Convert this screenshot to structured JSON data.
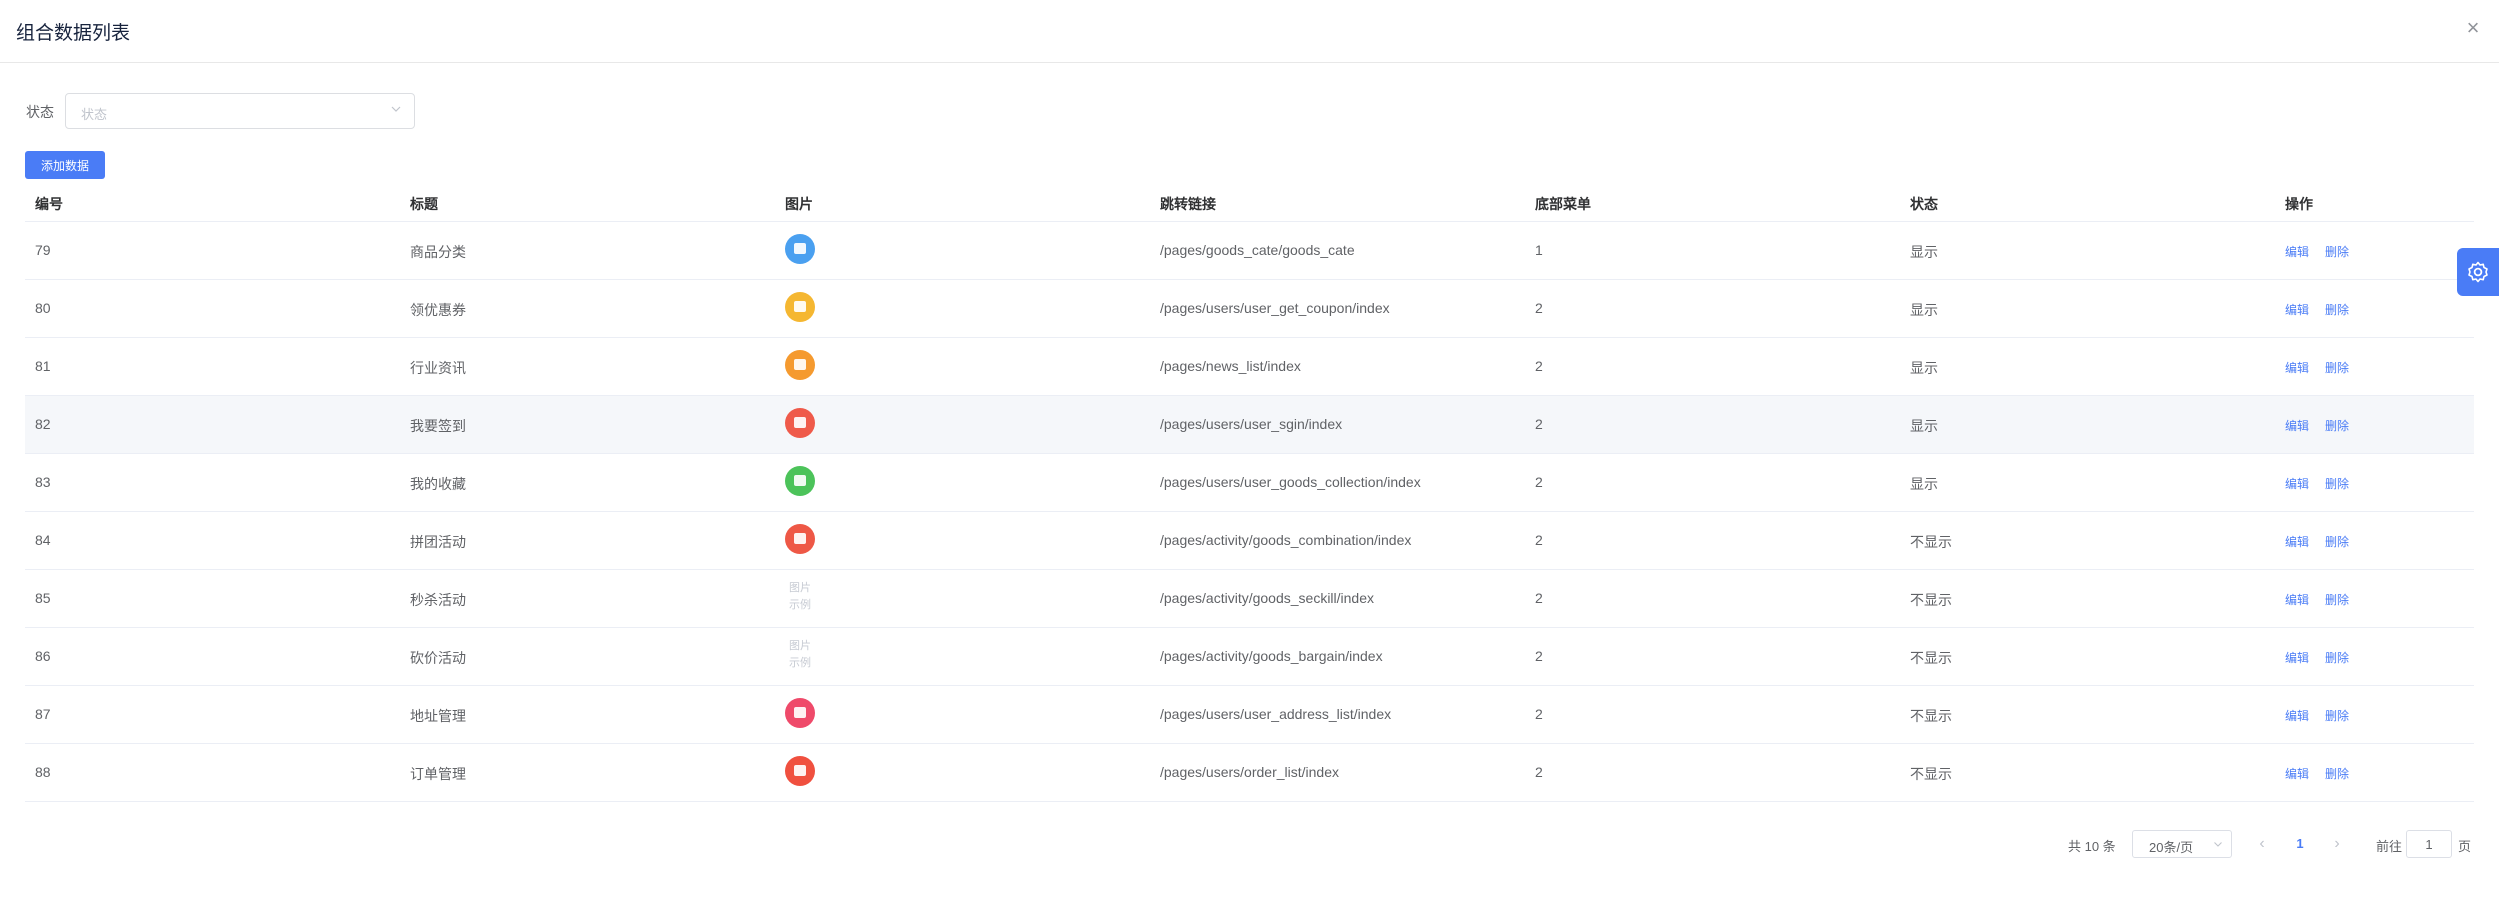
{
  "dialog": {
    "title": "组合数据列表",
    "close": "×"
  },
  "filter": {
    "label": "状态",
    "placeholder": "状态"
  },
  "toolbar": {
    "add_label": "添加数据"
  },
  "table": {
    "headers": [
      "编号",
      "标题",
      "图片",
      "跳转链接",
      "底部菜单",
      "状态",
      "操作"
    ],
    "rows": [
      {
        "id": "79",
        "title": "商品分类",
        "icon": "shop-icon",
        "color": "#4aa0f0",
        "link": "/pages/goods_cate/goods_cate",
        "menu": "1",
        "status": "显示"
      },
      {
        "id": "80",
        "title": "领优惠券",
        "icon": "coupon-icon",
        "color": "#f5b731",
        "link": "/pages/users/user_get_coupon/index",
        "menu": "2",
        "status": "显示"
      },
      {
        "id": "81",
        "title": "行业资讯",
        "icon": "news-icon",
        "color": "#f59a2f",
        "link": "/pages/news_list/index",
        "menu": "2",
        "status": "显示"
      },
      {
        "id": "82",
        "title": "我要签到",
        "icon": "calendar-icon",
        "color": "#ef5a4a",
        "link": "/pages/users/user_sgin/index",
        "menu": "2",
        "status": "显示"
      },
      {
        "id": "83",
        "title": "我的收藏",
        "icon": "collection-icon",
        "color": "#4cc35a",
        "link": "/pages/users/user_goods_collection/index",
        "menu": "2",
        "status": "显示"
      },
      {
        "id": "84",
        "title": "拼团活动",
        "icon": "group-buy-icon",
        "color": "#ee5846",
        "link": "/pages/activity/goods_combination/index",
        "menu": "2",
        "status": "不显示"
      },
      {
        "id": "85",
        "title": "秒杀活动",
        "icon": "image-placeholder-icon",
        "color": "",
        "link": "/pages/activity/goods_seckill/index",
        "menu": "2",
        "status": "不显示"
      },
      {
        "id": "86",
        "title": "砍价活动",
        "icon": "image-placeholder-icon",
        "color": "",
        "link": "/pages/activity/goods_bargain/index",
        "menu": "2",
        "status": "不显示"
      },
      {
        "id": "87",
        "title": "地址管理",
        "icon": "location-icon",
        "color": "#ef4a6a",
        "link": "/pages/users/user_address_list/index",
        "menu": "2",
        "status": "不显示"
      },
      {
        "id": "88",
        "title": "订单管理",
        "icon": "order-icon",
        "color": "#f0503f",
        "link": "/pages/users/order_list/index",
        "menu": "2",
        "status": "不显示"
      }
    ],
    "edit_label": "编辑",
    "delete_label": "删除"
  },
  "pagination": {
    "total": "共 10 条",
    "page_size": "20条/页",
    "current_page": "1",
    "goto_prefix": "前往",
    "goto_value": "1",
    "goto_suffix": "页",
    "prev": "‹",
    "next": "›"
  },
  "colors": {
    "primary": "#4a7cf6",
    "border": "#ebeef5",
    "hover_row": "#f5f7fa"
  },
  "placeholder_image": "图片\n示例"
}
